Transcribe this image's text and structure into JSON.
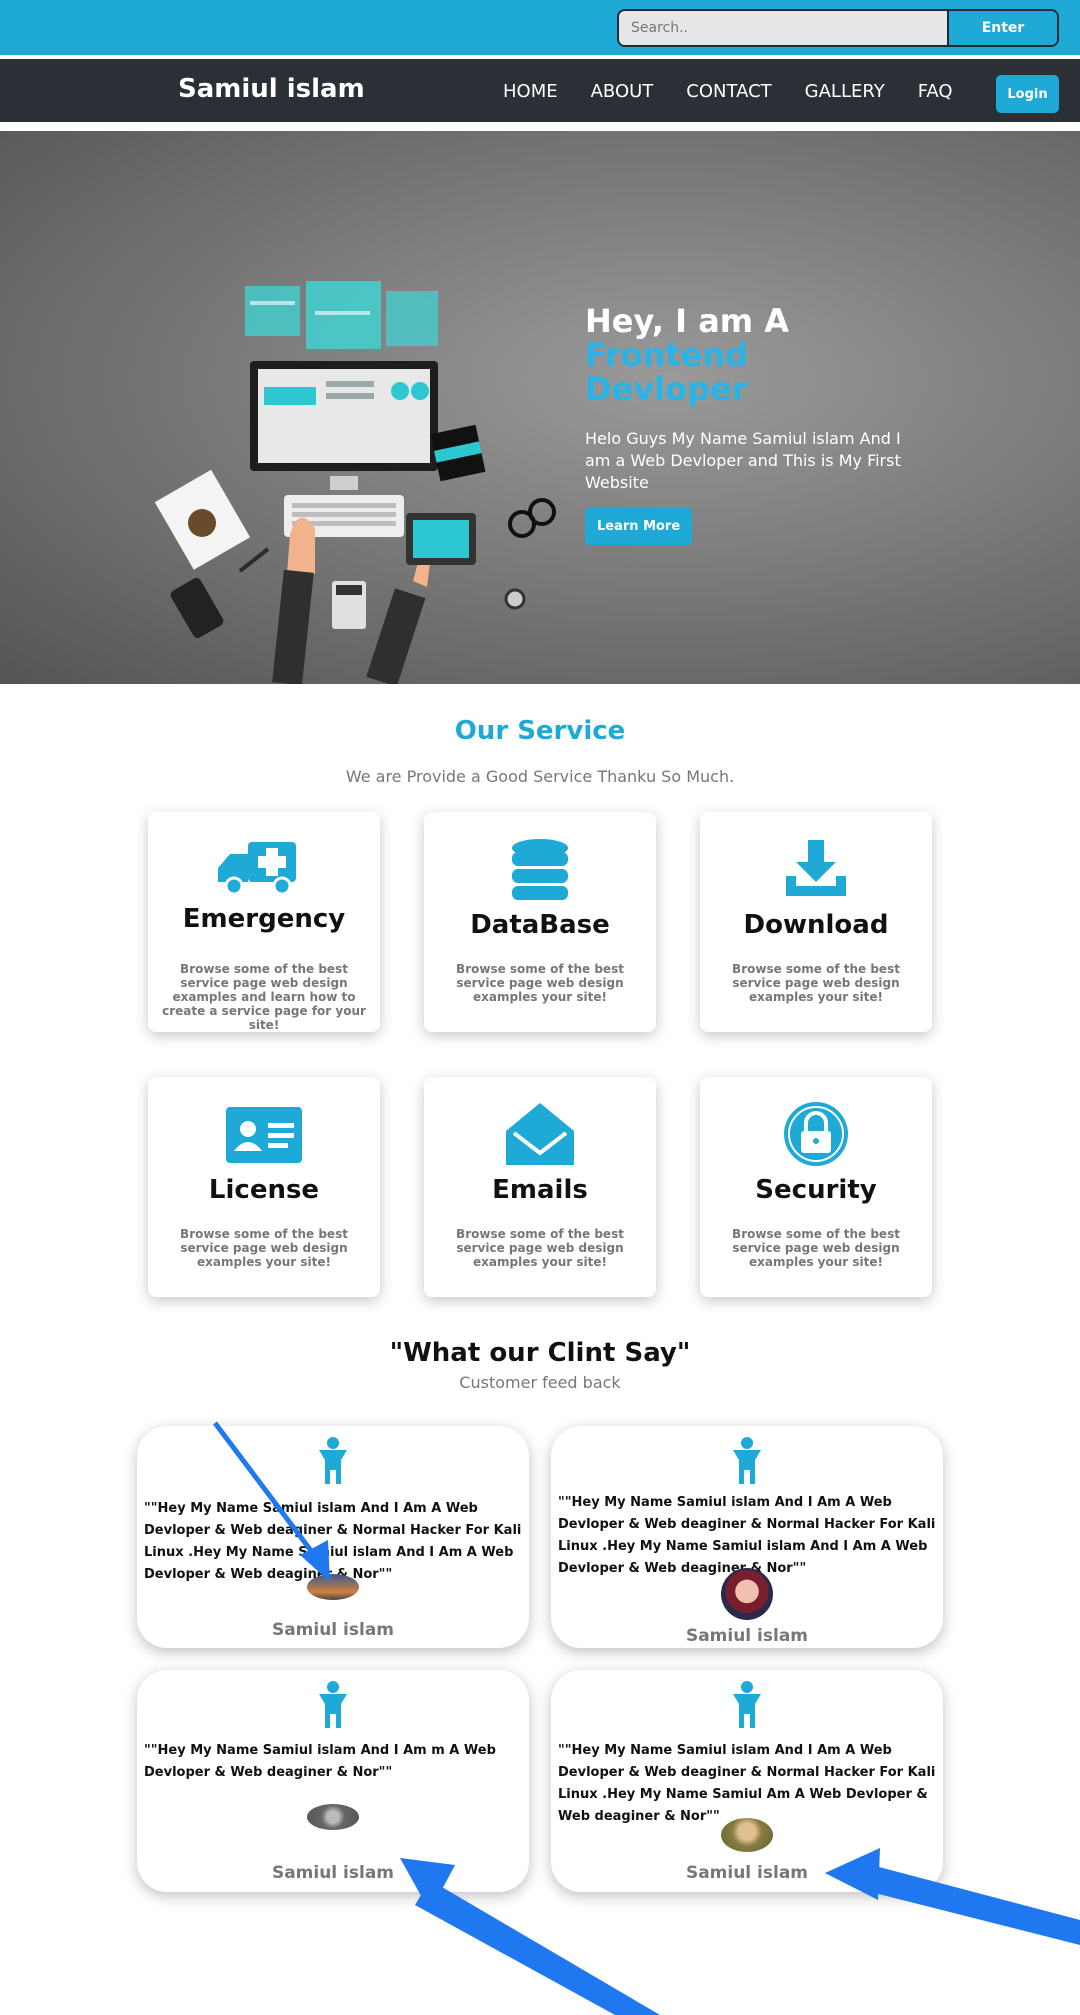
{
  "search": {
    "placeholder": "Search..",
    "button_label": "Enter"
  },
  "nav": {
    "brand": "Samiul islam",
    "links": [
      "HOME",
      "ABOUT",
      "CONTACT",
      "GALLERY",
      "FAQ"
    ],
    "login_label": "Login"
  },
  "hero": {
    "title_prefix": "Hey, I am A ",
    "title_accent": "Frontend Devloper",
    "description": "Helo Guys My Name Samiul islam And I am a Web Devloper and This is My First Website",
    "button_label": "Learn More"
  },
  "services": {
    "title": "Our Service",
    "subtitle": "We are Provide a Good Service Thanku So Much.",
    "items": [
      {
        "icon": "ambulance-icon",
        "title": "Emergency",
        "text": "Browse some of the best service page web design examples and learn how to create a service page for your site!"
      },
      {
        "icon": "database-icon",
        "title": "DataBase",
        "text": "Browse some of the best service page web design examples your site!"
      },
      {
        "icon": "download-icon",
        "title": "Download",
        "text": "Browse some of the best service page web design examples your site!"
      },
      {
        "icon": "id-card-icon",
        "title": "License",
        "text": "Browse some of the best service page web design examples your site!"
      },
      {
        "icon": "envelope-icon",
        "title": "Emails",
        "text": "Browse some of the best service page web design examples your site!"
      },
      {
        "icon": "lock-icon",
        "title": "Security",
        "text": "Browse some of the best service page web design examples your site!"
      }
    ]
  },
  "testimonials": {
    "title": "\"What our Clint Say\"",
    "subtitle": "Customer feed back",
    "items": [
      {
        "quote": "\"\"Hey My Name Samiul islam And I Am A Web Devloper & Web deaginer & Normal Hacker For Kali Linux .Hey My Name Samiul islam And I Am A Web Devloper & Web deaginer & Nor\"\"",
        "name": "Samiul islam"
      },
      {
        "quote": "\"\"Hey My Name Samiul islam And I Am A Web Devloper & Web deaginer & Normal Hacker For Kali Linux .Hey My Name Samiul islam And I Am A Web Devloper & Web deaginer & Nor\"\"",
        "name": "Samiul islam"
      },
      {
        "quote": "\"\"Hey My Name Samiul islam And I Am m A Web Devloper & Web deaginer & Nor\"\"",
        "name": "Samiul islam"
      },
      {
        "quote": "\"\"Hey My Name Samiul islam And I Am A Web Devloper & Web deaginer & Normal Hacker For Kali Linux .Hey My Name Samiul Am A Web Devloper & Web deaginer & Nor\"\"",
        "name": "Samiul islam"
      }
    ]
  },
  "colors": {
    "accent": "#1ea9d6",
    "nav_bg": "#2a3036",
    "annotation_arrow": "#1f78f0"
  }
}
